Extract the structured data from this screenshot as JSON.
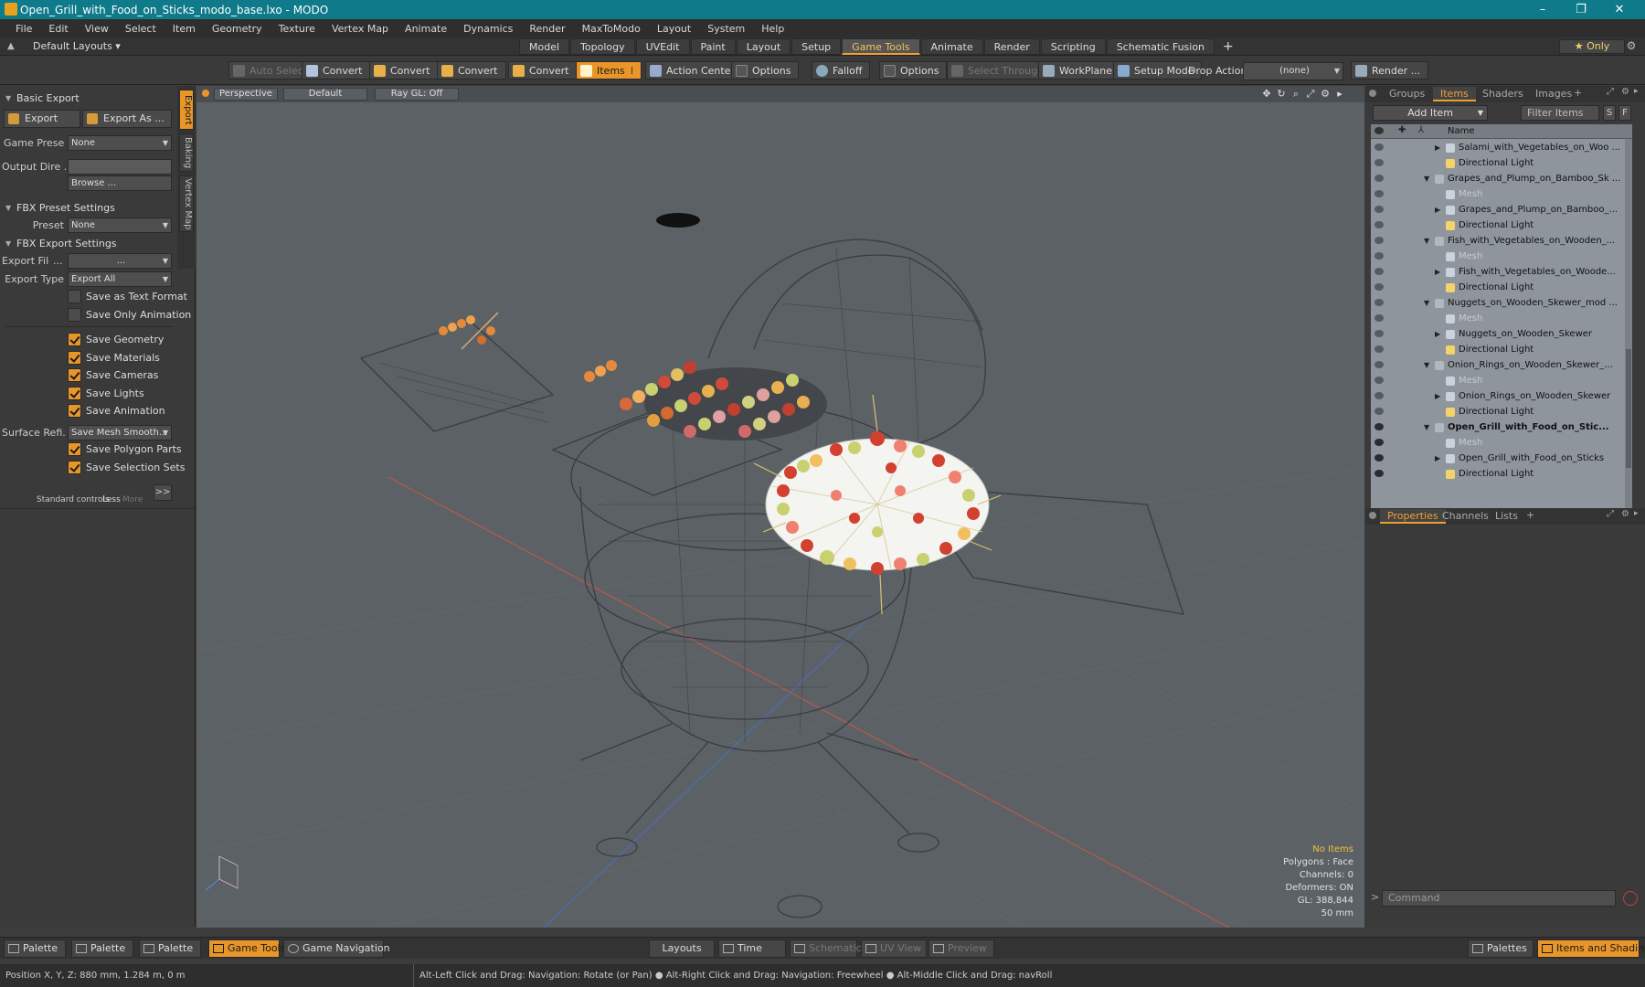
{
  "window": {
    "title": "Open_Grill_with_Food_on_Sticks_modo_base.lxo - MODO",
    "controls": [
      "–",
      "❐",
      "✕"
    ]
  },
  "menu": [
    "File",
    "Edit",
    "View",
    "Select",
    "Item",
    "Geometry",
    "Texture",
    "Vertex Map",
    "Animate",
    "Dynamics",
    "Render",
    "MaxToModo",
    "Layout",
    "System",
    "Help"
  ],
  "layout_bar": {
    "default_layouts": "Default Layouts ▾",
    "tabs": [
      "Model",
      "Topology",
      "UVEdit",
      "Paint",
      "Layout",
      "Setup",
      "Game Tools",
      "Animate",
      "Render",
      "Scripting",
      "Schematic Fusion"
    ],
    "active_tab": "Game Tools",
    "add_tab": "+",
    "only_label": "★  Only"
  },
  "toolbar": {
    "auto_select": "Auto Select",
    "convert_1": "Convert",
    "convert_2": "Convert",
    "convert_3": "Convert",
    "convert_4": "Convert",
    "items": "Items",
    "action_center": "Action Center",
    "options_1": "Options",
    "falloff": "Falloff",
    "options_2": "Options",
    "select_through": "Select Through",
    "workplane": "WorkPlane",
    "setup_mode": "Setup Mode",
    "drop_action": "Drop Action",
    "drop_value": "(none)",
    "render": "Render ..."
  },
  "left_panel": {
    "vtabs": [
      "Export",
      "Baking",
      "Vertex Map"
    ],
    "basic_export": "Basic Export",
    "export_btn": "Export",
    "export_as_btn": "Export As ...",
    "game_preset_label": "Game Preset",
    "game_preset_value": "None",
    "output_dir_label": "Output Dire ...",
    "browse": "Browse ...",
    "fbx_preset_settings": "FBX Preset Settings",
    "preset_label": "Preset",
    "preset_value": "None",
    "fbx_export_settings": "FBX Export Settings",
    "export_file_label": "Export File",
    "export_file_dots": "...",
    "export_file_value": "...",
    "export_type_label": "Export Type",
    "export_type_value": "Export All",
    "checks": [
      {
        "label": "Save as Text Format",
        "on": false
      },
      {
        "label": "Save Only Animation",
        "on": false
      },
      {
        "label": "Save Geometry",
        "on": true
      },
      {
        "label": "Save Materials",
        "on": true
      },
      {
        "label": "Save Cameras",
        "on": true
      },
      {
        "label": "Save Lights",
        "on": true
      },
      {
        "label": "Save Animation",
        "on": true
      }
    ],
    "surface_refi_label": "Surface Refi...",
    "surface_refi_value": "Save Mesh Smooth...",
    "checks2": [
      {
        "label": "Save Polygon Parts",
        "on": true
      },
      {
        "label": "Save Selection Sets",
        "on": true
      }
    ],
    "standard_controls": "Standard controls",
    "less": "Less",
    "more": "More",
    "expand": ">>"
  },
  "viewport": {
    "perspective": "Perspective",
    "default": "Default",
    "raygl": "Ray GL: Off",
    "info": {
      "no_items": "No Items",
      "polygons": "Polygons : Face",
      "channels": "Channels: 0",
      "deformers": "Deformers: ON",
      "gl": "GL: 388,844",
      "scale": "50 mm"
    }
  },
  "right_panel": {
    "tabs": [
      "Groups",
      "Items",
      "Shaders",
      "Images"
    ],
    "active_tab": "Items",
    "add_item": "Add Item",
    "filter_items": "Filter Items",
    "s_btn": "S",
    "f_btn": "F",
    "name_col": "Name",
    "rows": [
      {
        "indent": 2,
        "text": "Salami_with_Vegetables_on_Woo ...",
        "type": "mesh",
        "eye": false,
        "tri": "▶"
      },
      {
        "indent": 2,
        "text": "Directional Light",
        "type": "light",
        "eye": false,
        "tri": ""
      },
      {
        "indent": 1,
        "text": "Grapes_and_Plump_on_Bamboo_Sk ...",
        "type": "group",
        "eye": false,
        "tri": "▼"
      },
      {
        "indent": 2,
        "text": "Mesh",
        "type": "mesh",
        "eye": false,
        "tri": "",
        "dim": true
      },
      {
        "indent": 2,
        "text": "Grapes_and_Plump_on_Bamboo_...",
        "type": "mesh",
        "eye": false,
        "tri": "▶"
      },
      {
        "indent": 2,
        "text": "Directional Light",
        "type": "light",
        "eye": false,
        "tri": ""
      },
      {
        "indent": 1,
        "text": "Fish_with_Vegetables_on_Wooden_...",
        "type": "group",
        "eye": false,
        "tri": "▼"
      },
      {
        "indent": 2,
        "text": "Mesh",
        "type": "mesh",
        "eye": false,
        "tri": "",
        "dim": true
      },
      {
        "indent": 2,
        "text": "Fish_with_Vegetables_on_Woode...",
        "type": "mesh",
        "eye": false,
        "tri": "▶"
      },
      {
        "indent": 2,
        "text": "Directional Light",
        "type": "light",
        "eye": false,
        "tri": ""
      },
      {
        "indent": 1,
        "text": "Nuggets_on_Wooden_Skewer_mod ...",
        "type": "group",
        "eye": false,
        "tri": "▼"
      },
      {
        "indent": 2,
        "text": "Mesh",
        "type": "mesh",
        "eye": false,
        "tri": "",
        "dim": true
      },
      {
        "indent": 2,
        "text": "Nuggets_on_Wooden_Skewer",
        "type": "mesh",
        "eye": false,
        "tri": "▶"
      },
      {
        "indent": 2,
        "text": "Directional Light",
        "type": "light",
        "eye": false,
        "tri": ""
      },
      {
        "indent": 1,
        "text": "Onion_Rings_on_Wooden_Skewer_...",
        "type": "group",
        "eye": false,
        "tri": "▼"
      },
      {
        "indent": 2,
        "text": "Mesh",
        "type": "mesh",
        "eye": false,
        "tri": "",
        "dim": true
      },
      {
        "indent": 2,
        "text": "Onion_Rings_on_Wooden_Skewer",
        "type": "mesh",
        "eye": false,
        "tri": "▶"
      },
      {
        "indent": 2,
        "text": "Directional Light",
        "type": "light",
        "eye": false,
        "tri": ""
      },
      {
        "indent": 1,
        "text": "Open_Grill_with_Food_on_Stic...",
        "type": "group",
        "eye": true,
        "tri": "▼",
        "bold": true
      },
      {
        "indent": 2,
        "text": "Mesh",
        "type": "mesh",
        "eye": true,
        "tri": "",
        "dim": true
      },
      {
        "indent": 2,
        "text": "Open_Grill_with_Food_on_Sticks",
        "type": "mesh",
        "eye": true,
        "tri": "▶"
      },
      {
        "indent": 2,
        "text": "Directional Light",
        "type": "light",
        "eye": true,
        "tri": ""
      }
    ],
    "prop_tabs": [
      "Properties",
      "Channels",
      "Lists"
    ],
    "prop_add": "+",
    "command_placeholder": "Command",
    "cmd_prompt": ">"
  },
  "bottom_bar": {
    "palette_1": "Palette",
    "palette_2": "Palette",
    "palette_3": "Palette",
    "game_tools": "Game Tools",
    "game_navigation": "Game Navigation",
    "layouts": "Layouts",
    "time": "Time",
    "schematic": "Schematic",
    "uv_view": "UV View",
    "preview": "Preview",
    "palettes": "Palettes",
    "items_and_shading": "Items and Shading"
  },
  "status_bar": {
    "position": "Position X, Y, Z:   880 mm, 1.284 m, 0 m",
    "hint": "Alt-Left Click and Drag: Navigation: Rotate (or Pan) ● Alt-Right Click and Drag: Navigation: Freewheel ● Alt-Middle Click and Drag: navRoll"
  },
  "colors": {
    "accent": "#e8962a",
    "titlebar": "#0e7a8a",
    "viewport_bg": "#5c6166",
    "item_list_bg": "#8e959c"
  }
}
